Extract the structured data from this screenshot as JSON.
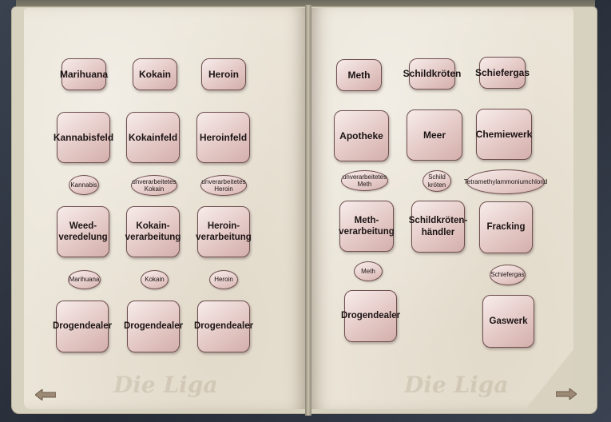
{
  "left_page": {
    "products": [
      {
        "label": "Marihuana"
      },
      {
        "label": "Kokain"
      },
      {
        "label": "Heroin"
      }
    ],
    "sources": [
      {
        "label": "Kannabisfeld"
      },
      {
        "label": "Kokainfeld"
      },
      {
        "label": "Heroinfeld"
      }
    ],
    "raw_items": [
      {
        "label": "Kannabis"
      },
      {
        "label": "unverarbeitetes\nKokain"
      },
      {
        "label": "unverarbeitetes\nHeroin"
      }
    ],
    "processors": [
      {
        "label": "Weed-\nveredelung"
      },
      {
        "label": "Kokain-\nverarbeitung"
      },
      {
        "label": "Heroin-\nverarbeitung"
      }
    ],
    "processed_items": [
      {
        "label": "Marihuana"
      },
      {
        "label": "Kokain"
      },
      {
        "label": "Heroin"
      }
    ],
    "dealers": [
      {
        "label": "Drogendealer"
      },
      {
        "label": "Drogendealer"
      },
      {
        "label": "Drogendealer"
      }
    ],
    "watermark": "Die Liga"
  },
  "right_page": {
    "products": [
      {
        "label": "Meth"
      },
      {
        "label": "Schildkröten"
      },
      {
        "label": "Schiefergas"
      }
    ],
    "sources": [
      {
        "label": "Apotheke"
      },
      {
        "label": "Meer"
      },
      {
        "label": "Chemiewerk"
      }
    ],
    "raw_items": [
      {
        "label": "unverarbeitetes\nMeth"
      },
      {
        "label": "Schild\nkröten"
      },
      {
        "label": "Tetramethylammoniumchlorid"
      }
    ],
    "processors": [
      {
        "label": "Meth-\nverarbeitung"
      },
      {
        "label": "Schildkröten-\nhändler"
      },
      {
        "label": "Fracking"
      }
    ],
    "processed_items": [
      {
        "label": "Meth"
      },
      {
        "label": "Schiefergas"
      }
    ],
    "dealers": [
      {
        "label": "Drogendealer"
      },
      {
        "label": "Gaswerk"
      }
    ],
    "watermark": "Die Liga"
  },
  "icons": {
    "prev": "arrow-left-icon",
    "next": "arrow-right-icon"
  }
}
